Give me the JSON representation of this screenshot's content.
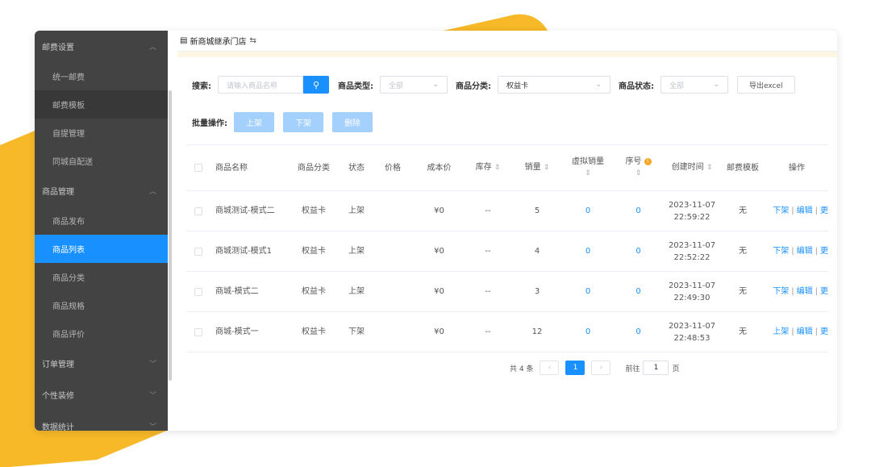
{
  "store": {
    "name": "新商城继承门店",
    "store_icon": "shop-icon",
    "switch_icon": "switch-icon"
  },
  "sidebar": {
    "groups": [
      {
        "label": "邮费设置",
        "expanded": true,
        "items": [
          "统一邮费",
          "邮费模板",
          "自提管理",
          "同城自配送"
        ]
      },
      {
        "label": "商品管理",
        "expanded": true,
        "items": [
          "商品发布",
          "商品列表",
          "商品分类",
          "商品规格",
          "商品评价"
        ]
      },
      {
        "label": "订单管理",
        "expanded": false,
        "items": []
      },
      {
        "label": "个性装修",
        "expanded": false,
        "items": []
      },
      {
        "label": "数据统计",
        "expanded": false,
        "items": []
      }
    ],
    "active_item": "商品列表"
  },
  "filters": {
    "search_label": "搜索:",
    "search_placeholder": "请输入商品名称",
    "type_label": "商品类型:",
    "type_value": "全部",
    "category_label": "商品分类:",
    "category_value": "权益卡",
    "status_label": "商品状态:",
    "status_value": "全部",
    "export_label": "导出excel"
  },
  "batch": {
    "label": "批量操作:",
    "buttons": [
      "上架",
      "下架",
      "删除"
    ]
  },
  "table": {
    "headers": {
      "name": "商品名称",
      "category": "商品分类",
      "status": "状态",
      "price": "价格",
      "cost": "成本价",
      "stock": "库存",
      "sales": "销量",
      "virtual_sales": "虚拟销量",
      "seq": "序号",
      "created": "创建时间",
      "template": "邮费模板",
      "ops": "操作"
    },
    "rows": [
      {
        "name": "商城测试-模式二",
        "category": "权益卡",
        "status": "上架",
        "price": "",
        "cost": "¥0",
        "stock": "--",
        "sales": "5",
        "virtual_sales": "0",
        "seq": "0",
        "date": "2023-11-07",
        "time": "22:59:22",
        "template": "无",
        "op1": "下架",
        "op2": "编辑",
        "op3": "更"
      },
      {
        "name": "商城测试-模式1",
        "category": "权益卡",
        "status": "上架",
        "price": "",
        "cost": "¥0",
        "stock": "--",
        "sales": "4",
        "virtual_sales": "0",
        "seq": "0",
        "date": "2023-11-07",
        "time": "22:52:22",
        "template": "无",
        "op1": "下架",
        "op2": "编辑",
        "op3": "更"
      },
      {
        "name": "商城-模式二",
        "category": "权益卡",
        "status": "上架",
        "price": "",
        "cost": "¥0",
        "stock": "--",
        "sales": "3",
        "virtual_sales": "0",
        "seq": "0",
        "date": "2023-11-07",
        "time": "22:49:30",
        "template": "无",
        "op1": "下架",
        "op2": "编辑",
        "op3": "更"
      },
      {
        "name": "商城-模式一",
        "category": "权益卡",
        "status": "下架",
        "price": "",
        "cost": "¥0",
        "stock": "--",
        "sales": "12",
        "virtual_sales": "0",
        "seq": "0",
        "date": "2023-11-07",
        "time": "22:48:53",
        "template": "无",
        "op1": "上架",
        "op2": "编辑",
        "op3": "更"
      }
    ]
  },
  "pagination": {
    "total": "共 4 条",
    "current_page": "1",
    "goto_label": "前往",
    "goto_value": "1",
    "page_suffix": "页"
  },
  "colors": {
    "accent": "#1890ff",
    "sidebar_bg": "#434343",
    "backdrop": "#f7b928"
  }
}
